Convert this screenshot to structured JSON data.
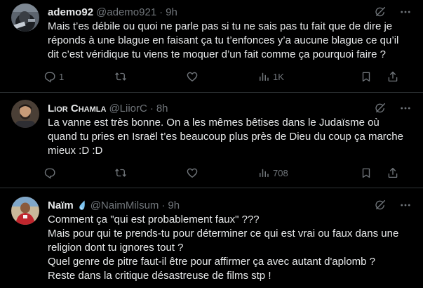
{
  "colors": {
    "background": "#000000",
    "text": "#e7e9ea",
    "muted": "#71767b",
    "divider": "#2f3336"
  },
  "tweets": [
    {
      "display_name": "ademo92",
      "handle": "@ademo921",
      "separator": "·",
      "time": "9h",
      "lines": [
        "Mais t’es débile ou quoi ne parle pas si tu ne sais pas tu fait que de dire je",
        "réponds à une blague en faisant ça tu t’enfonces y’a aucune blague ce qu’il",
        "dit c’est véridique tu viens te moquer d’un fait comme ça pourquoi faire ?"
      ],
      "reply_count": "1",
      "retweet_count": "",
      "like_count": "",
      "view_count": "1K",
      "icons": [
        "grok-icon",
        "more-icon",
        "reply-icon",
        "retweet-icon",
        "like-icon",
        "views-icon",
        "bookmark-icon",
        "share-icon"
      ]
    },
    {
      "display_name": "Lior Chamla",
      "handle": "@LiiorC",
      "separator": "·",
      "time": "8h",
      "lines": [
        "La vanne est très bonne. On a les mêmes bêtises dans le Judaïsme où",
        "quand tu pries en Israël t’es beaucoup plus près de Dieu du coup ça marche",
        "mieux :D :D"
      ],
      "reply_count": "",
      "retweet_count": "",
      "like_count": "",
      "view_count": "708",
      "icons": [
        "grok-icon",
        "more-icon",
        "reply-icon",
        "retweet-icon",
        "like-icon",
        "views-icon",
        "bookmark-icon",
        "share-icon"
      ]
    },
    {
      "display_name": "Naïm",
      "handle": "@NaimMilsum",
      "separator": "·",
      "time": "9h",
      "lines": [
        "Comment ça \"qui est probablement faux\" ???",
        "Mais pour qui te prends-tu pour déterminer ce qui est vrai ou faux dans une",
        "religion dont tu ignores tout ?",
        "Quel genre de pitre faut-il être pour affirmer ça avec autant d'aplomb ?",
        "Reste dans la critique désastreuse de films stp !"
      ],
      "icons": [
        "grok-icon",
        "more-icon",
        "droplet-emoji-icon"
      ]
    }
  ]
}
